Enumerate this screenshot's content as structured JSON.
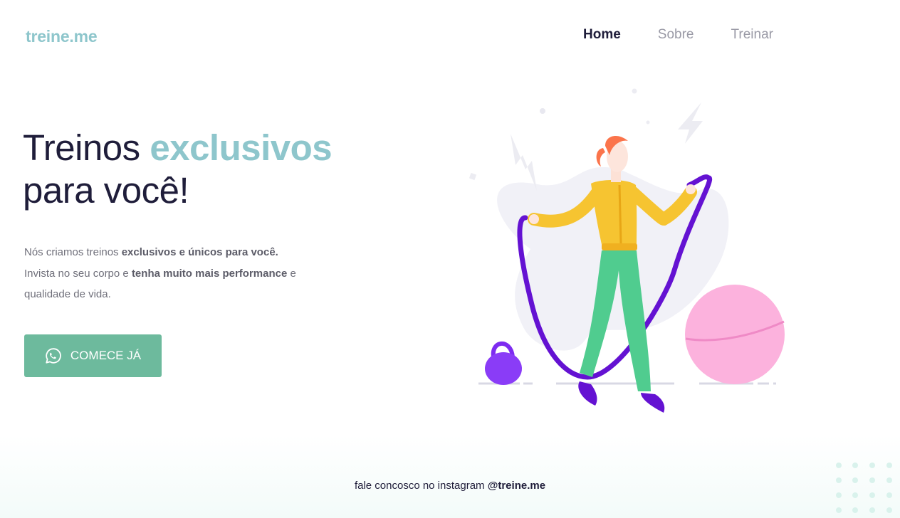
{
  "brand": {
    "logo": "treine.me"
  },
  "nav": {
    "items": [
      {
        "label": "Home",
        "active": true
      },
      {
        "label": "Sobre",
        "active": false
      },
      {
        "label": "Treinar",
        "active": false
      }
    ]
  },
  "hero": {
    "title_part1": "Treinos ",
    "title_accent": "exclusivos",
    "title_part2": "para você!",
    "desc": {
      "line1_plain": "Nós criamos treinos ",
      "line1_bold": "exclusivos e únicos para você.",
      "line2_plain1": "Invista no seu corpo e ",
      "line2_bold": "tenha muito mais performance",
      "line2_plain2": " e",
      "line3": "qualidade de vida."
    },
    "cta_label": "COMECE JÁ",
    "cta_icon": "whatsapp-icon"
  },
  "footer": {
    "text": "fale concosco no instagram ",
    "handle": "@treine.me"
  },
  "colors": {
    "accent": "#8ec6cc",
    "button": "#6dba9d",
    "heading": "#1f1d3a"
  }
}
